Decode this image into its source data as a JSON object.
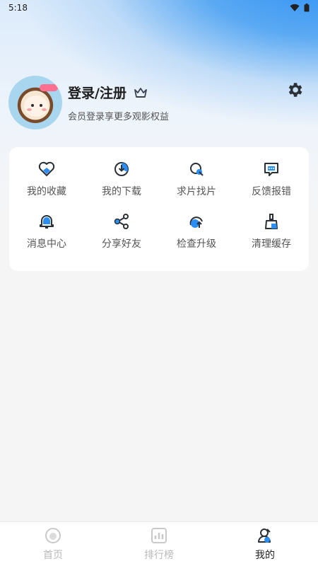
{
  "status_bar": {
    "time": "5:18"
  },
  "profile": {
    "title": "登录/注册",
    "subtitle": "会员登录享更多观影权益"
  },
  "grid_items": [
    {
      "label": "我的收藏",
      "icon": "heart-icon"
    },
    {
      "label": "我的下载",
      "icon": "download-icon"
    },
    {
      "label": "求片找片",
      "icon": "search-film-icon"
    },
    {
      "label": "反馈报错",
      "icon": "feedback-icon"
    },
    {
      "label": "消息中心",
      "icon": "bell-icon"
    },
    {
      "label": "分享好友",
      "icon": "share-icon"
    },
    {
      "label": "检查升级",
      "icon": "upgrade-icon"
    },
    {
      "label": "清理缓存",
      "icon": "broom-icon"
    }
  ],
  "tabbar": {
    "items": [
      {
        "label": "首页",
        "icon": "home-icon"
      },
      {
        "label": "排行榜",
        "icon": "ranking-icon"
      },
      {
        "label": "我的",
        "icon": "profile-icon",
        "active": true
      }
    ]
  },
  "colors": {
    "accent": "#2a8ef4",
    "icon_dark": "#2b2f36"
  }
}
